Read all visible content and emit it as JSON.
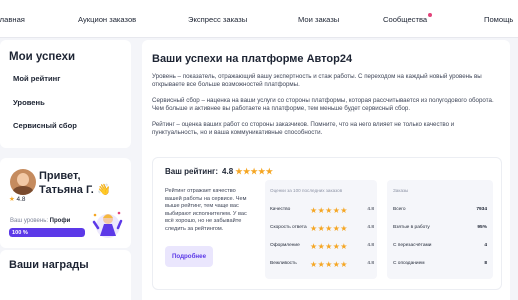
{
  "topnav": {
    "items": [
      "Главная",
      "Аукцион заказов",
      "Экспресс заказы",
      "Мои заказы",
      "Сообщества",
      "Помощь"
    ]
  },
  "sidebar": {
    "heading": "Мои успехи",
    "items": [
      "Мой рейтинг",
      "Уровень",
      "Сервисный сбор"
    ]
  },
  "profile": {
    "rating": "4.8",
    "greeting_line1": "Привет,",
    "greeting_line2": "Татьяна Г.",
    "wave_emoji": "👋",
    "level_prefix": "Ваш уровень:",
    "level_name": "Профи",
    "progress_text": "100 %",
    "progress_fraction": 1.0
  },
  "awards": {
    "heading": "Ваши награды"
  },
  "main": {
    "title": "Ваши успехи на платформе Автор24",
    "paragraphs": [
      "Уровень – показатель, отражающий вашу экспертность и стаж работы. С переходом на каждый новый уровень вы открываете все больше возможностей платформы.",
      "Сервисный сбор – наценка на ваши услуги со стороны платформы, которая рассчитывается из полугодового оборота. Чем больше и активнее вы работаете на платформе, тем меньше будет сервисный сбор.",
      "Рейтинг – оценка ваших работ со стороны заказчиков. Помните, что на него влияет не только качество и пунктуальность, но и ваша коммуникативные способности."
    ],
    "rating_block": {
      "label": "Ваш рейтинг:",
      "value": "4.8",
      "stars": "★★★★★",
      "description": "Рейтинг отражает качество вашей работы на сервисе. Чем выше рейтинг, тем чаще вас выбирают исполнителем. У вас всё хорошо, но не забывайте следить за рейтингом.",
      "more_button": "Подробнее"
    },
    "criteria": {
      "heading": "Оценки за 100 последних заказов",
      "rows": [
        {
          "label": "Качество",
          "stars": "★★★★★",
          "value": "4.8"
        },
        {
          "label": "Скорость ответа",
          "stars": "★★★★★",
          "value": "4.8"
        },
        {
          "label": "Оформление",
          "stars": "★★★★★",
          "value": "4.8"
        },
        {
          "label": "Вежливость",
          "stars": "★★★★★",
          "value": "4.8"
        }
      ]
    },
    "orders": {
      "heading": "Заказы",
      "rows": [
        {
          "label": "Всего",
          "value": "7934"
        },
        {
          "label": "Взятые в работу",
          "value": "95%"
        },
        {
          "label": "С перезасчётами",
          "value": "4"
        },
        {
          "label": "С опозданием",
          "value": "8"
        }
      ]
    }
  },
  "colors": {
    "accent": "#5c39e8",
    "star": "#f5a623",
    "notification": "#e2437a"
  }
}
